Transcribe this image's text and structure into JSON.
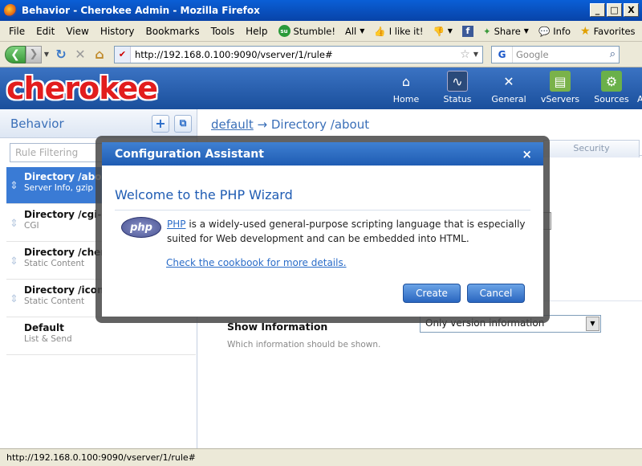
{
  "window": {
    "title": "Behavior - Cherokee Admin - Mozilla Firefox",
    "buttons": [
      "_",
      "□",
      "X"
    ]
  },
  "menubar": {
    "items": [
      "File",
      "Edit",
      "View",
      "History",
      "Bookmarks",
      "Tools",
      "Help"
    ],
    "toolbar": {
      "stumble": "Stumble!",
      "all": "All",
      "ilike": "I like it!",
      "share": "Share",
      "info": "Info",
      "favorites": "Favorites"
    }
  },
  "navbar": {
    "url": "http://192.168.0.100:9090/vserver/1/rule#",
    "search_placeholder": "Google"
  },
  "app": {
    "logo": "cherokee",
    "nav": [
      {
        "label": "Home",
        "icon": "home-icon"
      },
      {
        "label": "Status",
        "icon": "status-icon"
      },
      {
        "label": "General",
        "icon": "tools-icon"
      },
      {
        "label": "vServers",
        "icon": "vservers-icon"
      },
      {
        "label": "Sources",
        "icon": "sources-icon"
      },
      {
        "label": "Ad",
        "icon": "advanced-icon"
      }
    ]
  },
  "sidebar": {
    "title": "Behavior",
    "filter_placeholder": "Rule Filtering",
    "rules": [
      {
        "title": "Directory /about",
        "subtitle": "Server Info, gzip"
      },
      {
        "title": "Directory /cgi-bin",
        "subtitle": "CGI"
      },
      {
        "title": "Directory /cherokee",
        "subtitle": "Static Content"
      },
      {
        "title": "Directory /icons",
        "subtitle": "Static Content"
      },
      {
        "title": "Default",
        "subtitle": "List & Send"
      }
    ]
  },
  "main": {
    "breadcrumb_link": "default",
    "breadcrumb_rest": " → Directory /about",
    "security_tab": "Security",
    "show_info_label": "Show Information",
    "show_info_hint": "Which information should be shown.",
    "show_info_value": "Only version information"
  },
  "dialog": {
    "title": "Configuration Assistant",
    "close": "×",
    "heading": "Welcome to the PHP Wizard",
    "logo_text": "php",
    "desc_link": "PHP",
    "desc_rest": " is a widely-used general-purpose scripting language that is especially suited for Web development and can be embedded into HTML.",
    "cookbook": "Check the cookbook for more details.",
    "create": "Create",
    "cancel": "Cancel"
  },
  "statusbar": {
    "text": "http://192.168.0.100:9090/vserver/1/rule#"
  },
  "colors": {
    "accent": "#1f5cb3",
    "selection": "#3a7bd5",
    "logo": "#e21d1d"
  }
}
